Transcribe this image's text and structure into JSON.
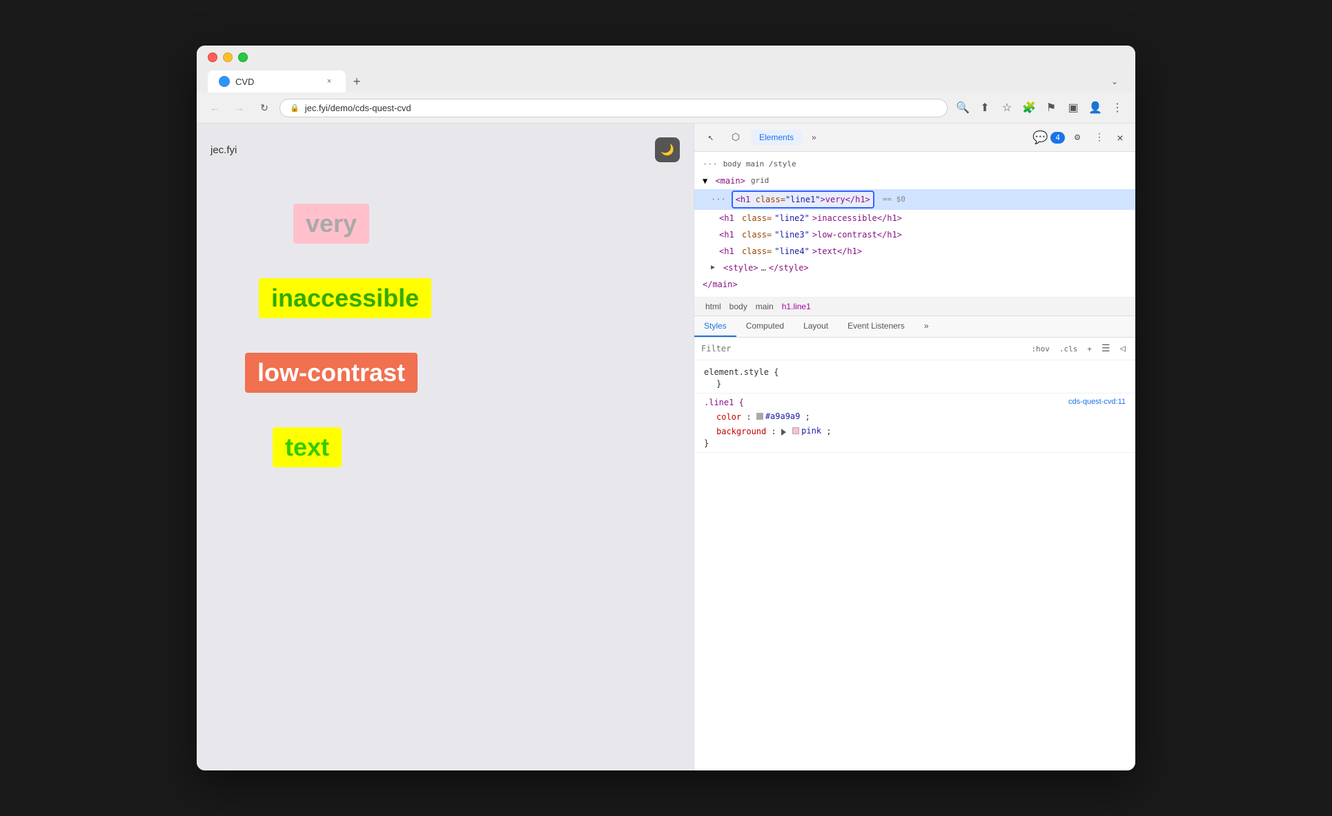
{
  "browser": {
    "traffic_lights": [
      "red",
      "yellow",
      "green"
    ],
    "tab": {
      "favicon_letter": "🌐",
      "title": "CVD",
      "close_label": "×"
    },
    "new_tab_label": "+",
    "overflow_label": "⌄",
    "nav": {
      "back_label": "←",
      "forward_label": "→",
      "refresh_label": "↻",
      "address": "jec.fyi/demo/cds-quest-cvd",
      "search_icon": "🔍",
      "share_icon": "⬆",
      "bookmark_icon": "☆",
      "extensions_icon": "🧩",
      "flag_icon": "⚑",
      "layout_icon": "▣",
      "profile_icon": "👤",
      "menu_icon": "⋮"
    }
  },
  "page": {
    "site_title": "jec.fyi",
    "dark_mode_icon": "🌙",
    "words": [
      {
        "text": "very",
        "bg": "#ffb6c1",
        "color": "#a9a9a9"
      },
      {
        "text": "inaccessible",
        "bg": "#ffff00",
        "color": "#33aa00"
      },
      {
        "text": "low-contrast",
        "bg": "#f07050",
        "color": "#ffffff"
      },
      {
        "text": "text",
        "bg": "#ffff00",
        "color": "#33cc00"
      }
    ]
  },
  "devtools": {
    "toolbar": {
      "inspector_icon": "⬡",
      "picker_icon": "↖",
      "device_icon": "📱",
      "panel_label": "Elements",
      "more_icon": "»",
      "badge_count": "4",
      "settings_icon": "⚙",
      "more_actions": "⋮",
      "close_label": "×"
    },
    "dom": {
      "lines": [
        {
          "indent": 0,
          "content": "▼ <main> grid",
          "type": "tag",
          "selected": false
        },
        {
          "indent": 1,
          "content": "<h1 class=\"line1\">very</h1> == $0",
          "type": "h1",
          "selected": true,
          "highlighted": true
        },
        {
          "indent": 2,
          "content": "<h1 class=\"line2\">inaccessible</h1>",
          "type": "h1",
          "selected": false
        },
        {
          "indent": 2,
          "content": "<h1 class=\"line3\">low-contrast</h1>",
          "type": "h1",
          "selected": false
        },
        {
          "indent": 2,
          "content": "<h1 class=\"line4\">text</h1>",
          "type": "h1",
          "selected": false
        },
        {
          "indent": 1,
          "content": "▶ <style>…</style>",
          "type": "style",
          "selected": false
        },
        {
          "indent": 0,
          "content": "</main>",
          "type": "close",
          "selected": false
        }
      ]
    },
    "breadcrumb": {
      "items": [
        "html",
        "body",
        "main",
        "h1.line1"
      ]
    },
    "styles": {
      "tabs": [
        "Styles",
        "Computed",
        "Layout",
        "Event Listeners",
        "»"
      ],
      "filter_placeholder": "Filter",
      "filter_actions": [
        ":hov",
        ".cls",
        "+",
        "☰",
        "◁"
      ],
      "rules": [
        {
          "selector": "element.style {",
          "origin": "",
          "properties": [],
          "close": "}"
        },
        {
          "selector": ".line1 {",
          "origin": "cds-quest-cvd:11",
          "properties": [
            {
              "name": "color",
              "value": "#a9a9a9",
              "type": "color",
              "swatch": "#a9a9a9"
            },
            {
              "name": "background",
              "value": "pink",
              "type": "color-expand",
              "swatch": "#ffb6c1"
            }
          ],
          "close": "}"
        }
      ]
    }
  }
}
